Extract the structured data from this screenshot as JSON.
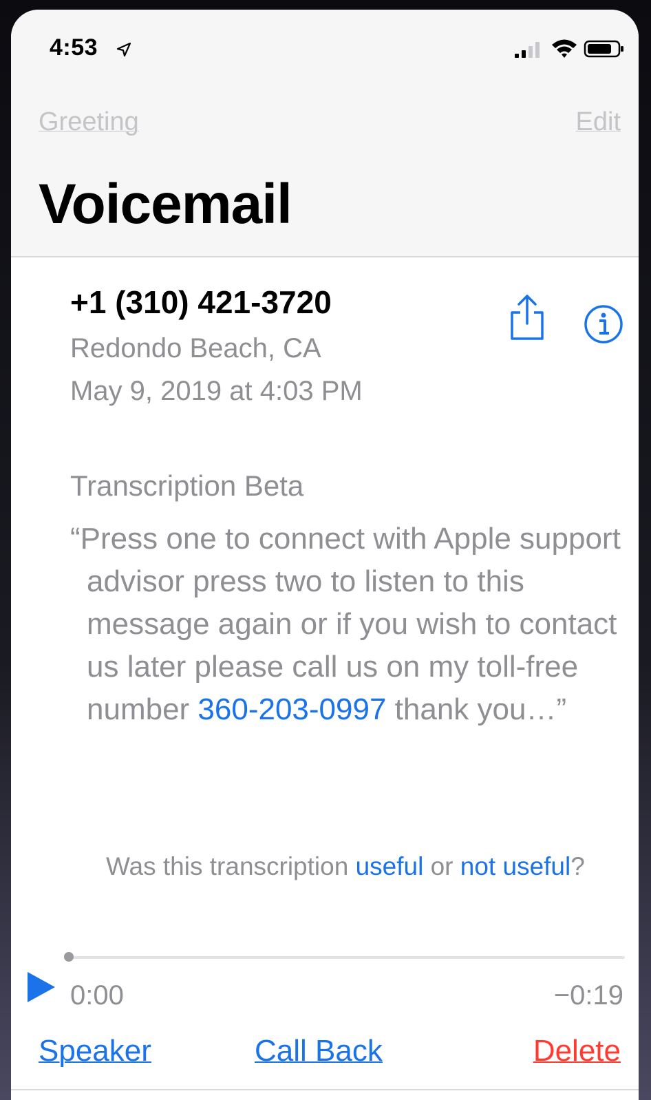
{
  "status_bar": {
    "time": "4:53",
    "location_icon": "location-arrow-icon",
    "signal_icon": "cellular-signal-icon",
    "wifi_icon": "wifi-icon",
    "battery_icon": "battery-icon"
  },
  "nav": {
    "left_label": "Greeting",
    "right_label": "Edit"
  },
  "title": "Voicemail",
  "message": {
    "caller": "+1 (310) 421-3720",
    "location": "Redondo Beach, CA",
    "datetime": "May 9, 2019 at 4:03 PM",
    "share_icon": "share-icon",
    "info_icon": "info-icon"
  },
  "transcription": {
    "heading": "Transcription Beta",
    "text_before_link": "“Press one to connect with Apple support advisor press two to listen to this message again or if you wish to contact us later please call us on my toll-free number ",
    "link_number": "360-203-0997",
    "text_after_link": " thank you…”",
    "feedback_prefix": "Was this transcription ",
    "feedback_useful": "useful",
    "feedback_or": " or ",
    "feedback_not_useful": "not useful",
    "feedback_suffix": "?"
  },
  "player": {
    "play_icon": "play-icon",
    "elapsed": "0:00",
    "remaining": "−0:19",
    "progress": 0
  },
  "actions": {
    "speaker": "Speaker",
    "call_back": "Call Back",
    "delete": "Delete"
  },
  "colors": {
    "accent": "#1a73e8",
    "destructive": "#ff3b30",
    "secondary_text": "#8e8e93"
  }
}
